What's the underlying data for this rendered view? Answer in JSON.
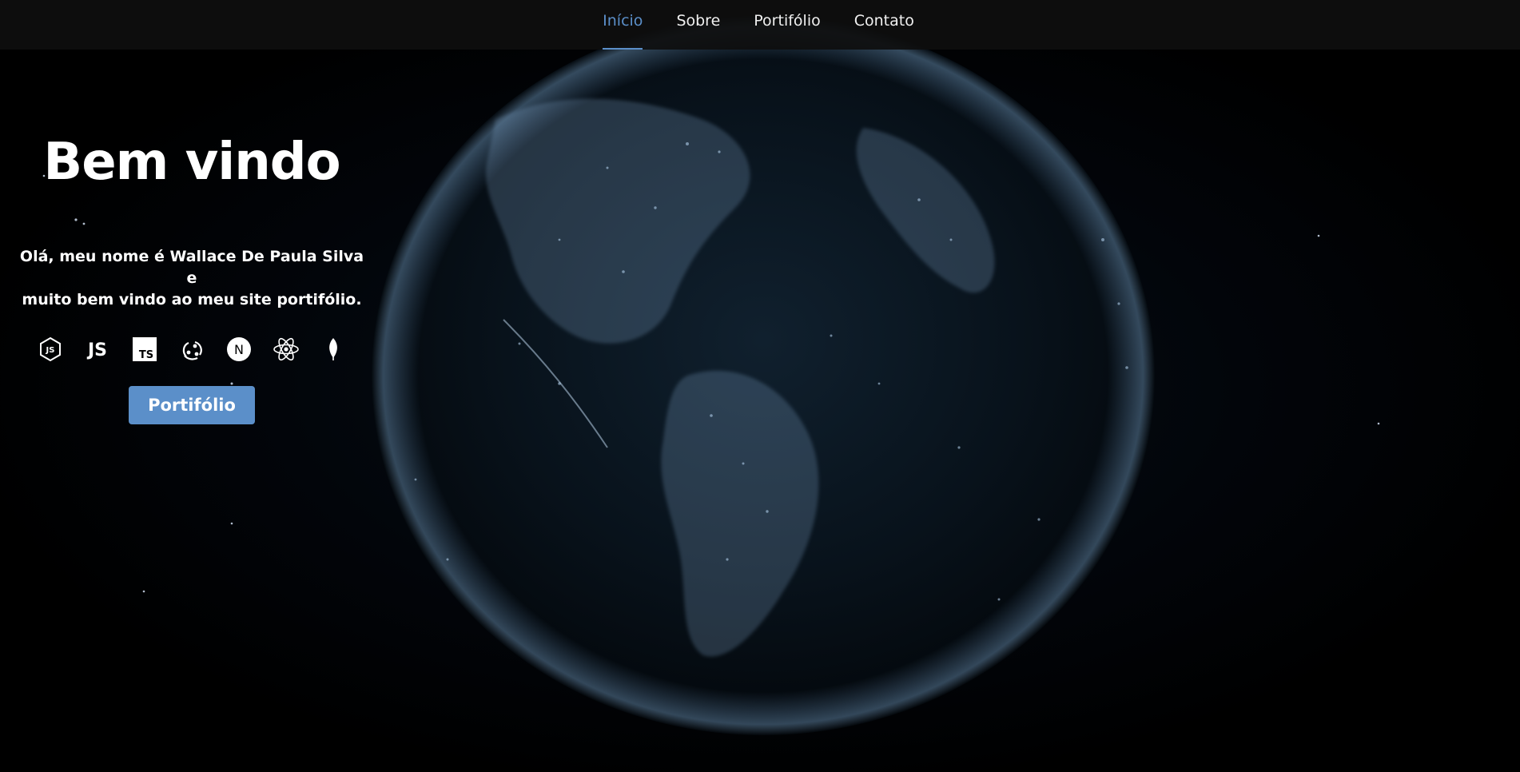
{
  "nav": {
    "items": [
      {
        "label": "Início",
        "active": true
      },
      {
        "label": "Sobre",
        "active": false
      },
      {
        "label": "Portifólio",
        "active": false
      },
      {
        "label": "Contato",
        "active": false
      }
    ]
  },
  "hero": {
    "title": "Bem vindo",
    "text_line1": "Olá, meu nome é Wallace De Paula Silva e",
    "text_line2": "muito bem vindo ao meu site portifólio.",
    "cta_label": "Portifólio",
    "tech_icons": [
      {
        "icon": "nodejs-icon",
        "text": "JS"
      },
      {
        "icon": "javascript-icon",
        "text": "JS"
      },
      {
        "icon": "typescript-icon",
        "text": "TS"
      },
      {
        "icon": "redux-icon"
      },
      {
        "icon": "nextjs-icon",
        "text": "N"
      },
      {
        "icon": "react-icon"
      },
      {
        "icon": "mongodb-icon"
      }
    ]
  },
  "colors": {
    "accent": "#5b8fc9",
    "nav_bg": "#0e0e0e",
    "background": "#000000"
  }
}
